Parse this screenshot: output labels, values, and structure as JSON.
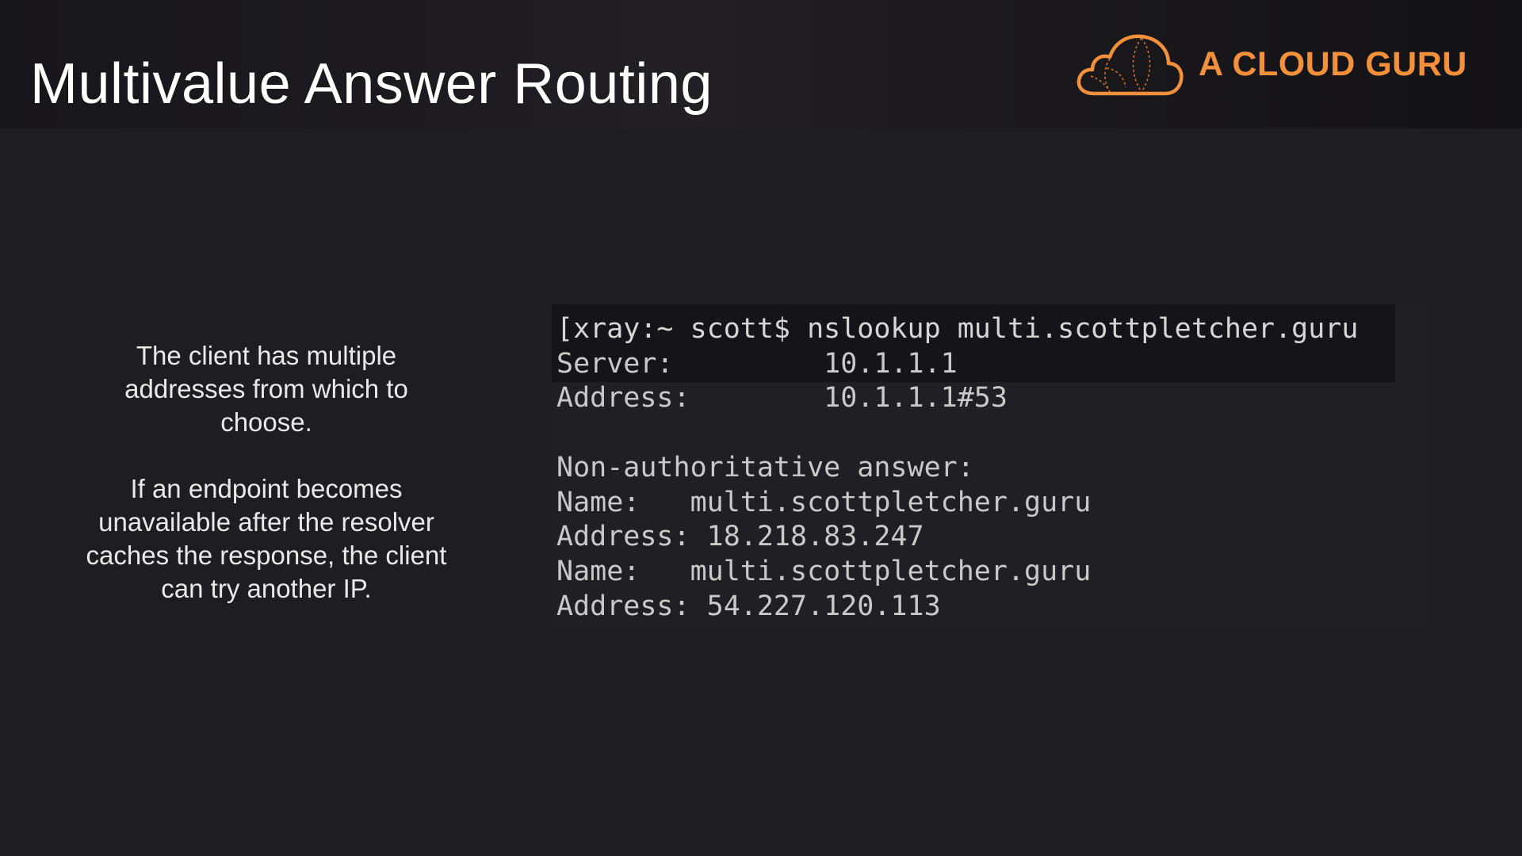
{
  "slide": {
    "title": "Multivalue Answer Routing",
    "accent_color": "#f2903c"
  },
  "logo": {
    "icon": "cloud-icon",
    "text": "A CLOUD GURU"
  },
  "body": {
    "paragraphs": [
      "The client has multiple addresses from which to choose.",
      "If an endpoint becomes unavailable after the resolver caches the response, the client can try another IP."
    ]
  },
  "terminal": {
    "lines": [
      "[xray:~ scott$ nslookup multi.scottpletcher.guru",
      "Server:         10.1.1.1",
      "Address:        10.1.1.1#53",
      "",
      "Non-authoritative answer:",
      "Name:   multi.scottpletcher.guru",
      "Address: 18.218.83.247",
      "Name:   multi.scottpletcher.guru",
      "Address: 54.227.120.113"
    ]
  }
}
